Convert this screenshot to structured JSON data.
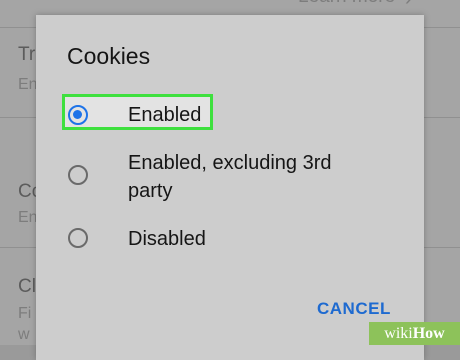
{
  "background": {
    "link_text": "Learn more",
    "chevron": "›",
    "rows": [
      {
        "title": "Tr",
        "sub": "En"
      },
      {
        "title": "Co",
        "sub": "En"
      },
      {
        "title": "Cl",
        "sub": "Fi"
      }
    ],
    "extra_sub": "w"
  },
  "dialog": {
    "title": "Cookies",
    "options": [
      {
        "line1": "Enabled",
        "line2": ""
      },
      {
        "line1": "Enabled, excluding 3rd",
        "line2": "party"
      },
      {
        "line1": "Disabled",
        "line2": ""
      }
    ],
    "selected_option": "Enabled",
    "cancel_label": "CANCEL",
    "accent_color": "#1e73e8",
    "highlight_color": "#3ee03e"
  },
  "watermark": {
    "part1": "wiki",
    "part2": "How"
  }
}
